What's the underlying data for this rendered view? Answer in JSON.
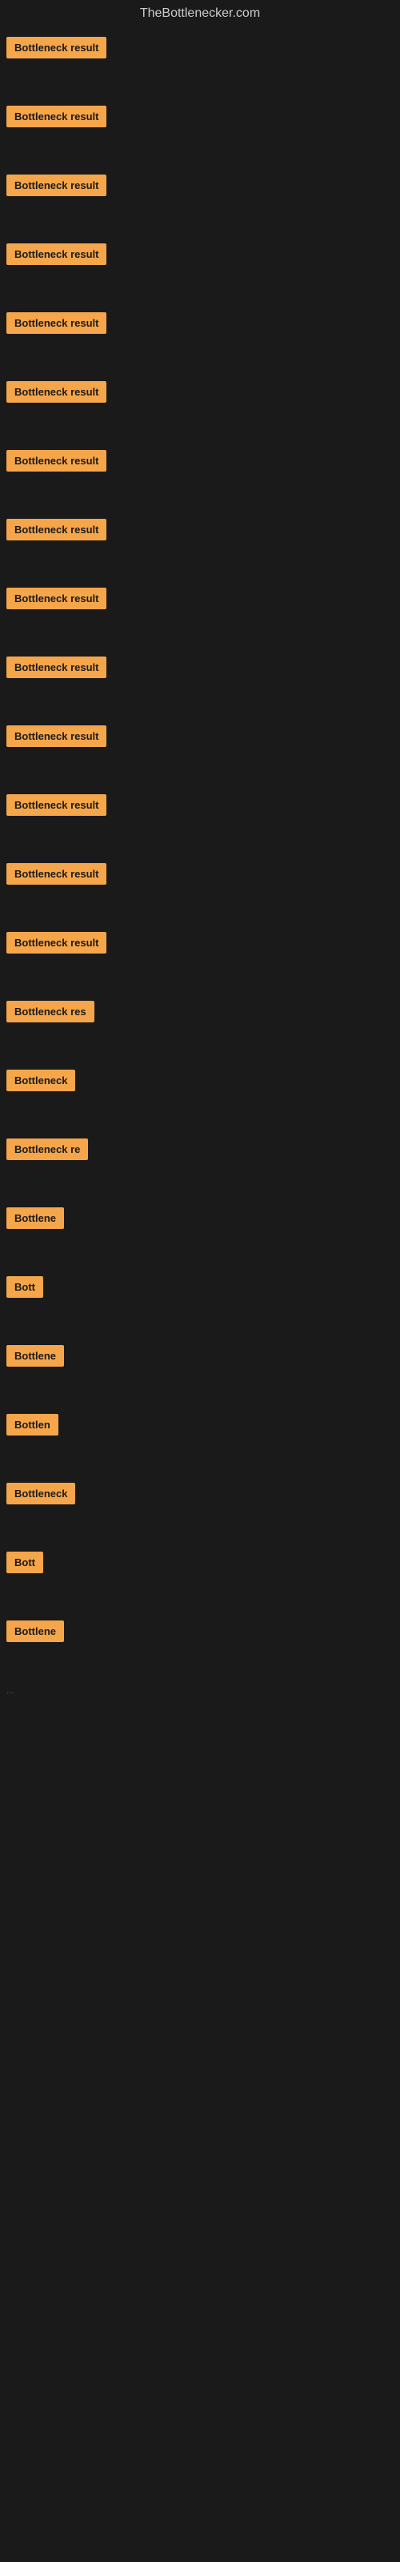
{
  "site": {
    "title": "TheBottlenecker.com"
  },
  "items": [
    {
      "id": 1,
      "label": "Bottleneck result",
      "width": 130
    },
    {
      "id": 2,
      "label": "Bottleneck result",
      "width": 130
    },
    {
      "id": 3,
      "label": "Bottleneck result",
      "width": 130
    },
    {
      "id": 4,
      "label": "Bottleneck result",
      "width": 130
    },
    {
      "id": 5,
      "label": "Bottleneck result",
      "width": 130
    },
    {
      "id": 6,
      "label": "Bottleneck result",
      "width": 130
    },
    {
      "id": 7,
      "label": "Bottleneck result",
      "width": 130
    },
    {
      "id": 8,
      "label": "Bottleneck result",
      "width": 130
    },
    {
      "id": 9,
      "label": "Bottleneck result",
      "width": 130
    },
    {
      "id": 10,
      "label": "Bottleneck result",
      "width": 130
    },
    {
      "id": 11,
      "label": "Bottleneck result",
      "width": 130
    },
    {
      "id": 12,
      "label": "Bottleneck result",
      "width": 130
    },
    {
      "id": 13,
      "label": "Bottleneck result",
      "width": 130
    },
    {
      "id": 14,
      "label": "Bottleneck result",
      "width": 130
    },
    {
      "id": 15,
      "label": "Bottleneck res",
      "width": 108
    },
    {
      "id": 16,
      "label": "Bottleneck",
      "width": 82
    },
    {
      "id": 17,
      "label": "Bottleneck re",
      "width": 96
    },
    {
      "id": 18,
      "label": "Bottlene",
      "width": 70
    },
    {
      "id": 19,
      "label": "Bott",
      "width": 42
    },
    {
      "id": 20,
      "label": "Bottlene",
      "width": 70
    },
    {
      "id": 21,
      "label": "Bottlen",
      "width": 63
    },
    {
      "id": 22,
      "label": "Bottleneck",
      "width": 82
    },
    {
      "id": 23,
      "label": "Bott",
      "width": 40
    },
    {
      "id": 24,
      "label": "Bottlene",
      "width": 70
    }
  ],
  "ellipsis": "..."
}
